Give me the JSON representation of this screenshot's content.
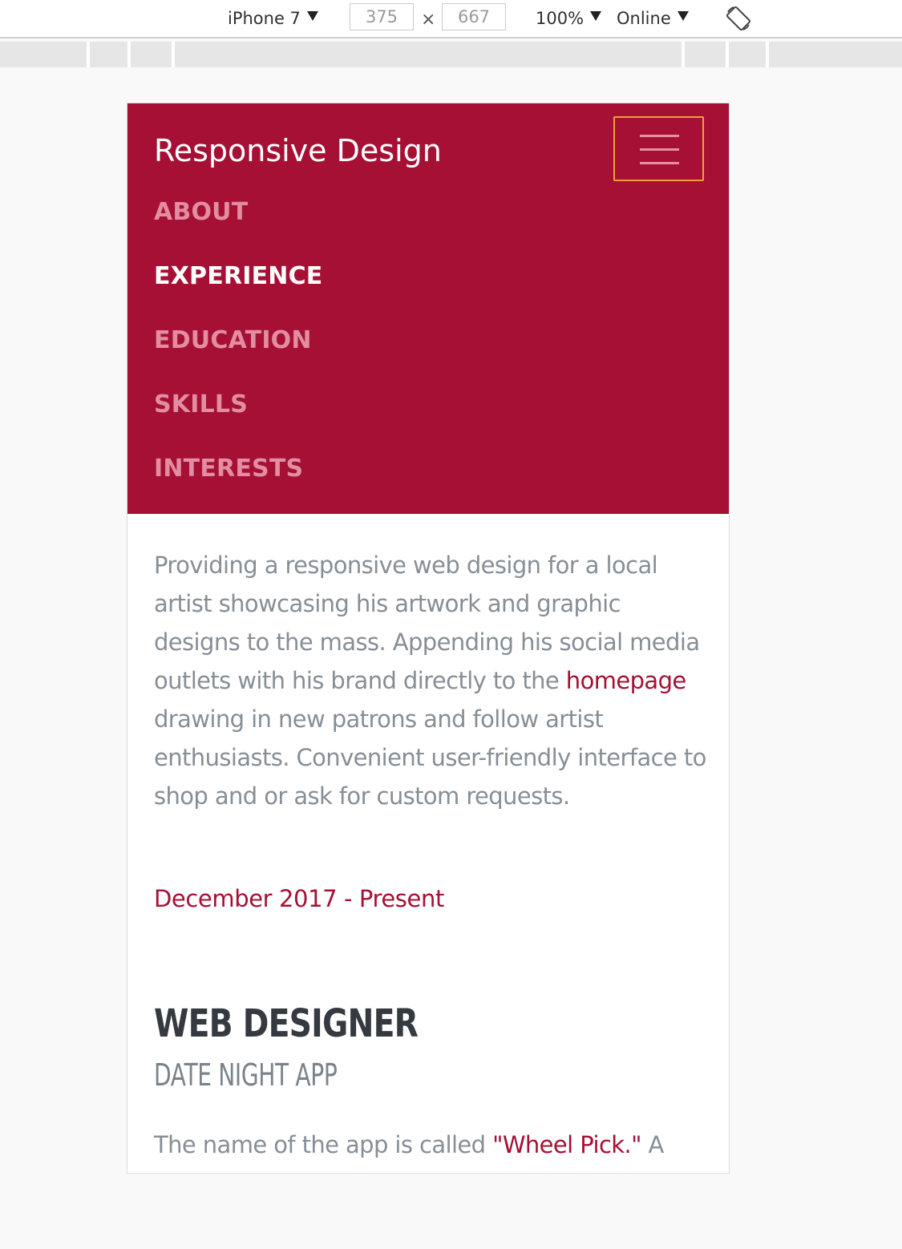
{
  "devtools": {
    "device": "iPhone 7",
    "width": "375",
    "times": "×",
    "height": "667",
    "zoom": "100%",
    "network": "Online",
    "icons": {
      "dropdown": "caret-down-icon",
      "rotate": "rotate-device-icon"
    }
  },
  "site": {
    "brand": "Responsive Design",
    "nav": [
      {
        "label": "ABOUT",
        "active": false
      },
      {
        "label": "EXPERIENCE",
        "active": true
      },
      {
        "label": "EDUCATION",
        "active": false
      },
      {
        "label": "SKILLS",
        "active": false
      },
      {
        "label": "INTERESTS",
        "active": false
      }
    ],
    "toggler_icon": "hamburger-menu-icon"
  },
  "content": {
    "desc_before": "Providing a responsive web design for a local artist showcasing his artwork and graphic designs to the mass. Appending his social media outlets with his brand directly to the ",
    "desc_link": "homepage",
    "desc_after": " drawing in new patrons and follow artist enthusiasts. Convenient user-friendly interface to shop and or ask for custom requests.",
    "date": "December 2017 - Present",
    "job_title": "WEB DESIGNER",
    "job_subtitle": "DATE NIGHT APP",
    "teaser_before": "The name of the app is called ",
    "teaser_link": "\"Wheel Pick.\"",
    "teaser_after": " A"
  },
  "colors": {
    "primary": "#a51034",
    "nav_inactive": "#e38da2",
    "toggler_border": "#e8a33b",
    "body_text": "#868e96",
    "heading": "#343a40"
  }
}
